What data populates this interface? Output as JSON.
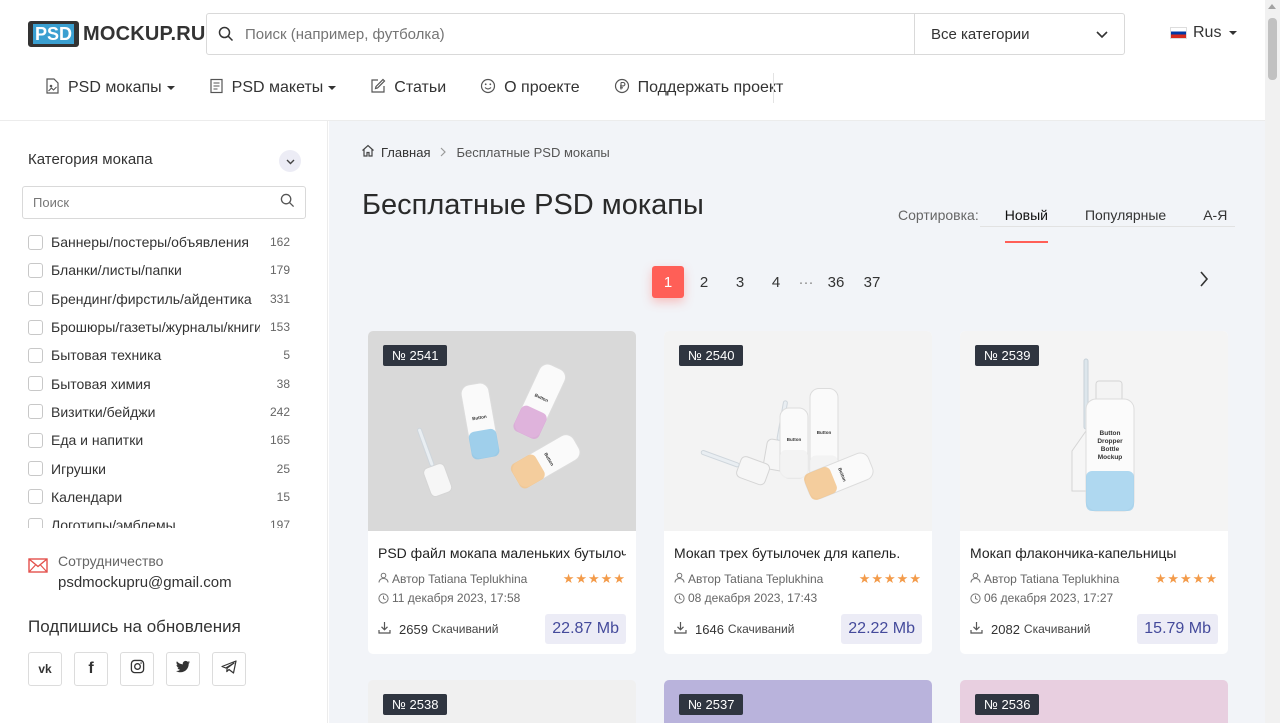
{
  "header": {
    "logo_psd": "PSD",
    "logo_text": "MOCKUP.RU",
    "search_placeholder": "Поиск (например, футболка)",
    "category_select": "Все категории",
    "language": "Rus"
  },
  "nav": [
    {
      "label": "PSD мокапы",
      "dropdown": true
    },
    {
      "label": "PSD макеты",
      "dropdown": true
    },
    {
      "label": "Статьи"
    },
    {
      "label": "О проекте"
    },
    {
      "label": "Поддержать проект"
    }
  ],
  "sidebar": {
    "heading": "Категория мокапа",
    "search_placeholder": "Поиск",
    "categories": [
      {
        "name": "Баннеры/постеры/объявления",
        "count": "162"
      },
      {
        "name": "Бланки/листы/папки",
        "count": "179"
      },
      {
        "name": "Брендинг/фирстиль/айдентика",
        "count": "331"
      },
      {
        "name": "Брошюры/газеты/журналы/книги",
        "count": "153"
      },
      {
        "name": "Бытовая техника",
        "count": "5"
      },
      {
        "name": "Бытовая химия",
        "count": "38"
      },
      {
        "name": "Визитки/бейджи",
        "count": "242"
      },
      {
        "name": "Еда и напитки",
        "count": "165"
      },
      {
        "name": "Игрушки",
        "count": "25"
      },
      {
        "name": "Календари",
        "count": "15"
      },
      {
        "name": "Логотипы/эмблемы",
        "count": "197"
      }
    ],
    "contact_label": "Сотрудничество",
    "contact_email": "psdmockupru@gmail.com",
    "subscribe_title": "Подпишись на обновления"
  },
  "breadcrumb": {
    "home": "Главная",
    "current": "Бесплатные PSD мокапы"
  },
  "page_title": "Бесплатные PSD мокапы",
  "sort": {
    "label": "Сортировка:",
    "options": [
      "Новый",
      "Популярные",
      "А-Я"
    ],
    "active": "Новый"
  },
  "pagination": {
    "pages": [
      "1",
      "2",
      "3",
      "4"
    ],
    "dots": "···",
    "last_pages": [
      "36",
      "37"
    ],
    "current": "1"
  },
  "cards": [
    {
      "badge": "№ 2541",
      "title": "PSD файл мокапа маленьких бутылочек",
      "author": "Автор Tatiana Teplukhina",
      "date": "11 декабря 2023, 17:58",
      "downloads": "2659",
      "downloads_label": "Скачиваний",
      "size": "22.87 Mb",
      "stars": "★★★★★",
      "bg": "#d9d9d9"
    },
    {
      "badge": "№ 2540",
      "title": "Мокап трех бутылочек для капель.",
      "author": "Автор Tatiana Teplukhina",
      "date": "08 декабря 2023, 17:43",
      "downloads": "1646",
      "downloads_label": "Скачиваний",
      "size": "22.22 Mb",
      "stars": "★★★★★",
      "bg": "#f3f3f3"
    },
    {
      "badge": "№ 2539",
      "title": "Мокап флакончика-капельницы",
      "author": "Автор Tatiana Teplukhina",
      "date": "06 декабря 2023, 17:27",
      "downloads": "2082",
      "downloads_label": "Скачиваний",
      "size": "15.79 Mb",
      "stars": "★★★★★",
      "bg": "#f4f4f4"
    }
  ],
  "next_cards": [
    {
      "badge": "№ 2538",
      "bg": "#f0f0f0"
    },
    {
      "badge": "№ 2537",
      "bg": "#b9b3dc"
    },
    {
      "badge": "№ 2536",
      "bg": "#e8cfe0"
    }
  ]
}
